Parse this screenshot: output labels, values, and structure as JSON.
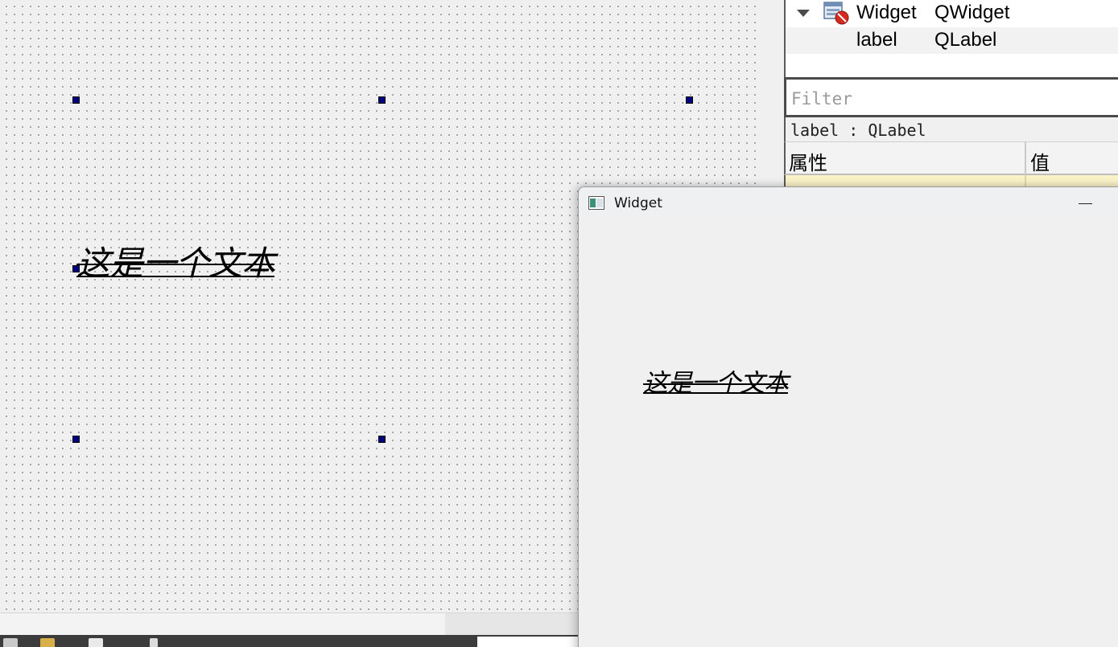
{
  "designer": {
    "label_text": "这是一个文本"
  },
  "object_inspector": {
    "rows": [
      {
        "name": "Widget",
        "class": "QWidget"
      },
      {
        "name": "label",
        "class": "QLabel"
      }
    ]
  },
  "property_editor": {
    "filter_placeholder": "Filter",
    "selected_caption": "label : QLabel",
    "header_property": "属性",
    "header_value": "值"
  },
  "run_window": {
    "title": "Widget",
    "label_text": "这是一个文本"
  },
  "colors": {
    "selection_handle": "#000080",
    "property_row_highlight": "#fbf3c8"
  },
  "icons": {
    "tree_expand": "triangle-down-icon",
    "widget_class": "widget-form-icon",
    "window_app": "window-app-icon",
    "minimize": "minimize-icon"
  }
}
